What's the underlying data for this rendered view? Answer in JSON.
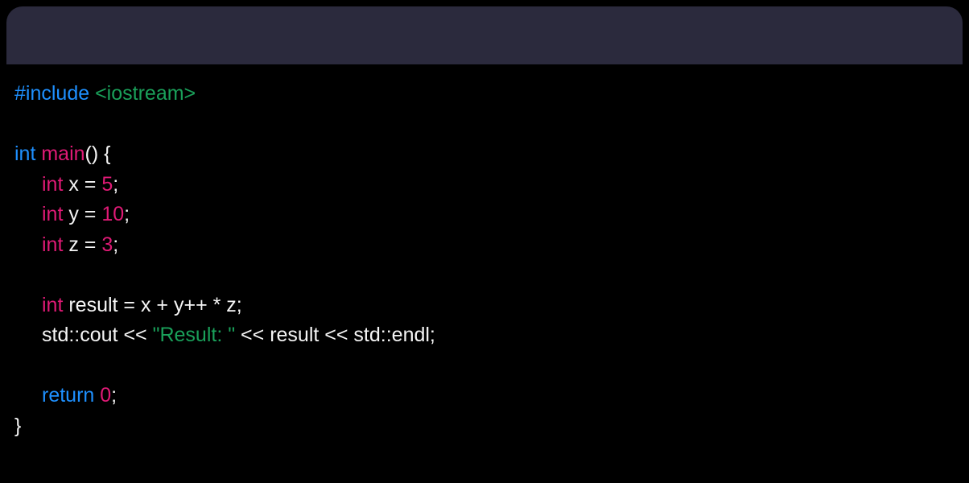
{
  "code": {
    "line1": {
      "hash": "#",
      "include": "include",
      "header": " <iostream>"
    },
    "line3": {
      "type": "int",
      "func": " main",
      "rest": "() {"
    },
    "line4": {
      "type": "int",
      "rest": " x = ",
      "num": "5",
      "semi": ";"
    },
    "line5": {
      "type": "int",
      "rest": " y = ",
      "num": "10",
      "semi": ";"
    },
    "line6": {
      "type": "int",
      "rest": " z = ",
      "num": "3",
      "semi": ";"
    },
    "line8": {
      "type": "int",
      "rest": " result = x + y++ * z;"
    },
    "line9": {
      "pre": "std::cout << ",
      "str": "\"Result: \"",
      "post": " << result << std::endl;"
    },
    "line11": {
      "ret": "return",
      "space": " ",
      "num": "0",
      "semi": ";"
    },
    "line12": {
      "brace": "}"
    }
  }
}
